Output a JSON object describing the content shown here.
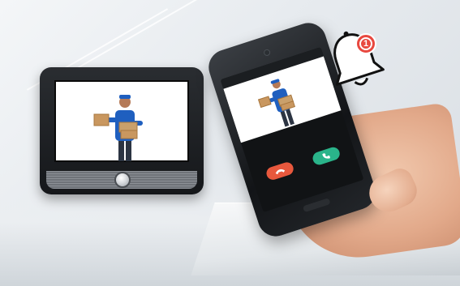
{
  "scene": {
    "description_icons": [
      "doorbell-monitor-icon",
      "smartphone-icon",
      "bell-icon"
    ]
  },
  "notification": {
    "badge_count": "1",
    "badge_color": "#e8483f"
  },
  "phone": {
    "decline_color": "#e8583d",
    "answer_color": "#2ab48a"
  }
}
